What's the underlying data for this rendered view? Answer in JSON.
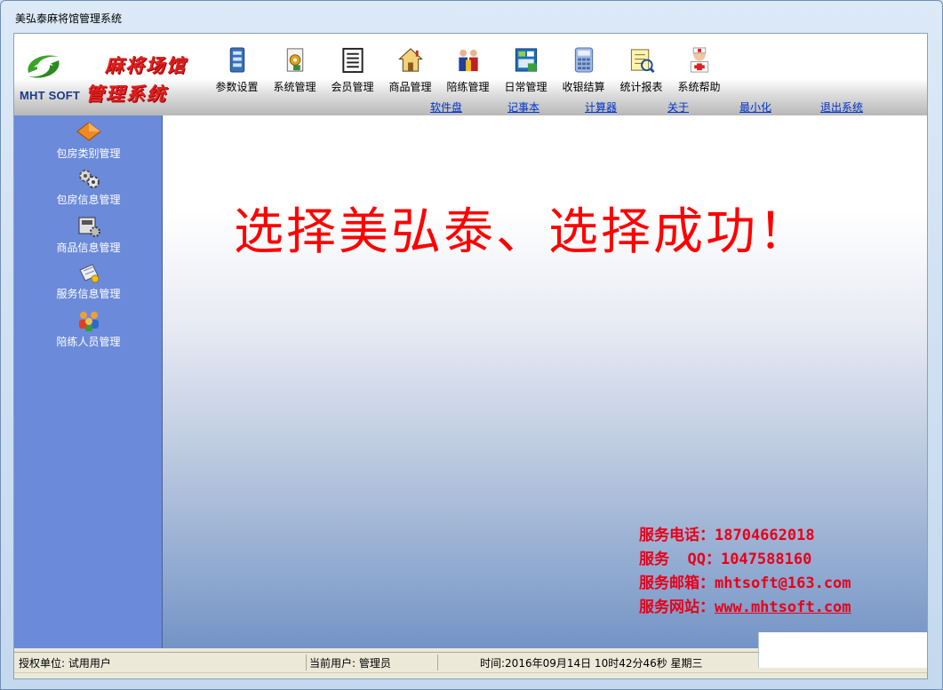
{
  "window": {
    "title": "美弘泰麻将馆管理系统"
  },
  "logo": {
    "brand": "MHT SOFT",
    "line1": "麻将场馆",
    "line2": "管理系统"
  },
  "toolbar": [
    {
      "label": "参数设置",
      "icon": "parameter-settings-icon"
    },
    {
      "label": "系统管理",
      "icon": "system-management-icon"
    },
    {
      "label": "会员管理",
      "icon": "member-management-icon"
    },
    {
      "label": "商品管理",
      "icon": "goods-management-icon"
    },
    {
      "label": "陪练管理",
      "icon": "trainer-management-icon"
    },
    {
      "label": "日常管理",
      "icon": "daily-management-icon"
    },
    {
      "label": "收银结算",
      "icon": "cashier-calculator-icon"
    },
    {
      "label": "统计报表",
      "icon": "statistics-report-icon"
    },
    {
      "label": "系统帮助",
      "icon": "help-medic-icon"
    }
  ],
  "links": [
    "软件盘",
    "记事本",
    "计算器",
    "关于",
    "最小化",
    "退出系统"
  ],
  "sidebar": [
    {
      "label": "包房类别管理",
      "icon": "room-category-icon"
    },
    {
      "label": "包房信息管理",
      "icon": "room-info-gears-icon"
    },
    {
      "label": "商品信息管理",
      "icon": "goods-info-icon"
    },
    {
      "label": "服务信息管理",
      "icon": "service-info-icon"
    },
    {
      "label": "陪练人员管理",
      "icon": "trainer-staff-icon"
    }
  ],
  "main": {
    "slogan": "选择美弘泰、选择成功！",
    "contact": {
      "phone_label": "服务电话：",
      "phone": "18704662018",
      "qq_label": "服务  QQ：",
      "qq": "1047588160",
      "email_label": "服务邮箱：",
      "email": "mhtsoft@163.com",
      "site_label": "服务网站：",
      "site": "www.mhtsoft.com"
    }
  },
  "statusbar": {
    "auth": "授权单位: 试用用户",
    "user": "当前用户: 管理员",
    "time": "时间:2016年09月14日  10时42分46秒  星期三"
  },
  "colors": {
    "sidebar": "#6b8ad9",
    "slogan": "#ff0000",
    "contact": "#e8001a",
    "link": "#0033cc"
  }
}
